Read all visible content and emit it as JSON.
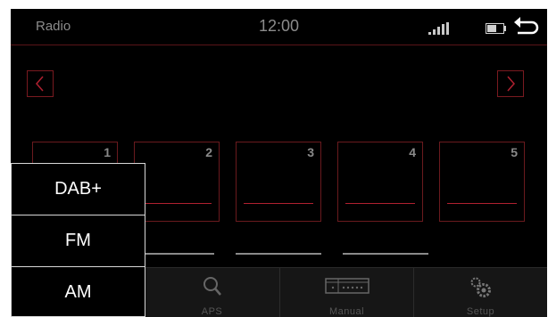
{
  "status": {
    "title": "Radio",
    "time": "12:00"
  },
  "presets": [
    {
      "number": "1"
    },
    {
      "number": "2"
    },
    {
      "number": "3"
    },
    {
      "number": "4"
    },
    {
      "number": "5"
    }
  ],
  "bottom_bar": {
    "aps_label": "APS",
    "manual_label": "Manual",
    "setup_label": "Setup"
  },
  "band_menu": {
    "items": [
      "DAB+",
      "FM",
      "AM"
    ]
  },
  "colors": {
    "accent": "#c0182a",
    "background": "#000000"
  }
}
